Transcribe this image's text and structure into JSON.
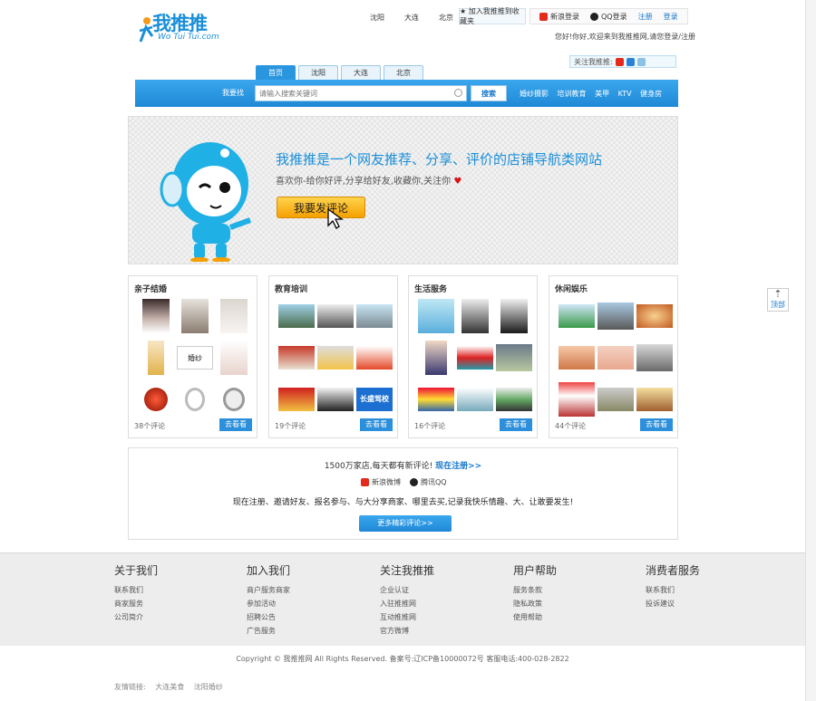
{
  "logo": {
    "text": "我推推",
    "sub": "Wo Tui Tui.com"
  },
  "topnav": [
    "沈阳",
    "大连",
    "北京"
  ],
  "fav_label": "★ 加入我推推到收藏夹",
  "login": {
    "sina": "新浪登录",
    "qq": "QQ登录",
    "register": "注册",
    "signin": "登录"
  },
  "hello": "您好!你好,欢迎来到我推推网,请您登录/注册",
  "follow_label": "关注我推推:",
  "city_tabs": [
    "首页",
    "沈阳",
    "大连",
    "北京"
  ],
  "search": {
    "label": "我要找",
    "placeholder": "请输入搜索关键词",
    "button": "搜索",
    "hot": [
      "婚纱摄影",
      "培训教育",
      "美甲",
      "KTV",
      "健身房"
    ]
  },
  "banner": {
    "title": "我推推是一个网友推荐、分享、评价的店铺导航类网站",
    "subtitle": "喜欢你-给你好评,分享给好友,收藏你,关注你",
    "button": "我要发评论"
  },
  "categories": [
    {
      "title": "亲子结婚",
      "count": "38个评论",
      "button": "去看看",
      "thumbs": [
        "bride-photo",
        "wedding-photo",
        "wedding-photo",
        "ring-box",
        "shop-sign",
        "wedding-photo",
        "gold-ring",
        "silver-ring",
        "silver-ring"
      ],
      "thumb_labels": [
        "",
        "",
        "",
        "",
        "婚纱",
        "",
        "",
        "",
        ""
      ]
    },
    {
      "title": "教育培训",
      "count": "19个评论",
      "button": "去看看",
      "thumbs": [
        "car-photo",
        "car-photo",
        "car-photo",
        "storefront",
        "school-bus",
        "logo-card",
        "sign-board",
        "car-photo",
        "driving-school"
      ],
      "thumb_labels": [
        "",
        "",
        "",
        "",
        "",
        "",
        "",
        "",
        "长盛驾校"
      ]
    },
    {
      "title": "生活服务",
      "count": "16个评论",
      "button": "去看看",
      "thumbs": [
        "poster",
        "suit-man",
        "suit-man",
        "uniform-woman",
        "office-photo",
        "street-photo",
        "group-photo",
        "chart-poster",
        "shop-interior"
      ],
      "thumb_labels": [
        "",
        "",
        "",
        "",
        "",
        "",
        "",
        "",
        ""
      ]
    },
    {
      "title": "休闲娱乐",
      "count": "44个评论",
      "button": "去看看",
      "thumbs": [
        "hotel-photo",
        "hotel-photo",
        "food-plate",
        "spa-photo",
        "nail-photo",
        "shop-interior",
        "restaurant-sign",
        "shop-interior",
        "storefront"
      ],
      "thumb_labels": [
        "",
        "",
        "",
        "",
        "",
        "",
        "",
        "",
        ""
      ]
    }
  ],
  "invite": {
    "line1_a": "1500万家店,每天都有新评论!",
    "line1_b": "现在注册>>",
    "login_sina": "新浪微博",
    "login_qq": "腾讯QQ",
    "line2": "现在注册、邀请好友、报名参与、与大分享商家、哪里去买,记录我快乐情趣、大、让敢要发生!",
    "button": "更多精彩评论>>"
  },
  "footer": {
    "cols": [
      {
        "head": "关于我们",
        "items": [
          "联系我们",
          "商家服务",
          "公司简介"
        ]
      },
      {
        "head": "加入我们",
        "items": [
          "商户服务商家",
          "参加活动",
          "招聘公告",
          "广告服务"
        ]
      },
      {
        "head": "关注我推推",
        "items": [
          "企业认证",
          "入驻推推网",
          "互动推推网",
          "官方微博"
        ]
      },
      {
        "head": "用户帮助",
        "items": [
          "服务条款",
          "隐私政策",
          "使用帮助"
        ]
      },
      {
        "head": "消费者服务",
        "items": [
          "联系我们",
          "投诉建议"
        ]
      }
    ],
    "copyright": "Copyright © 我推推网 All Rights Reserved.   备案号:辽ICP备10000072号  客服电话:400-028-2822",
    "links_label": "友情链接:",
    "links": [
      "大连美食",
      "沈阳婚纱"
    ]
  },
  "backtop": "顶部",
  "colors": {
    "brand_blue": "#1a8fd8",
    "button_blue": "#2b8fdb",
    "banner_orange": "#f5a000",
    "heart_red": "#d9141b"
  }
}
